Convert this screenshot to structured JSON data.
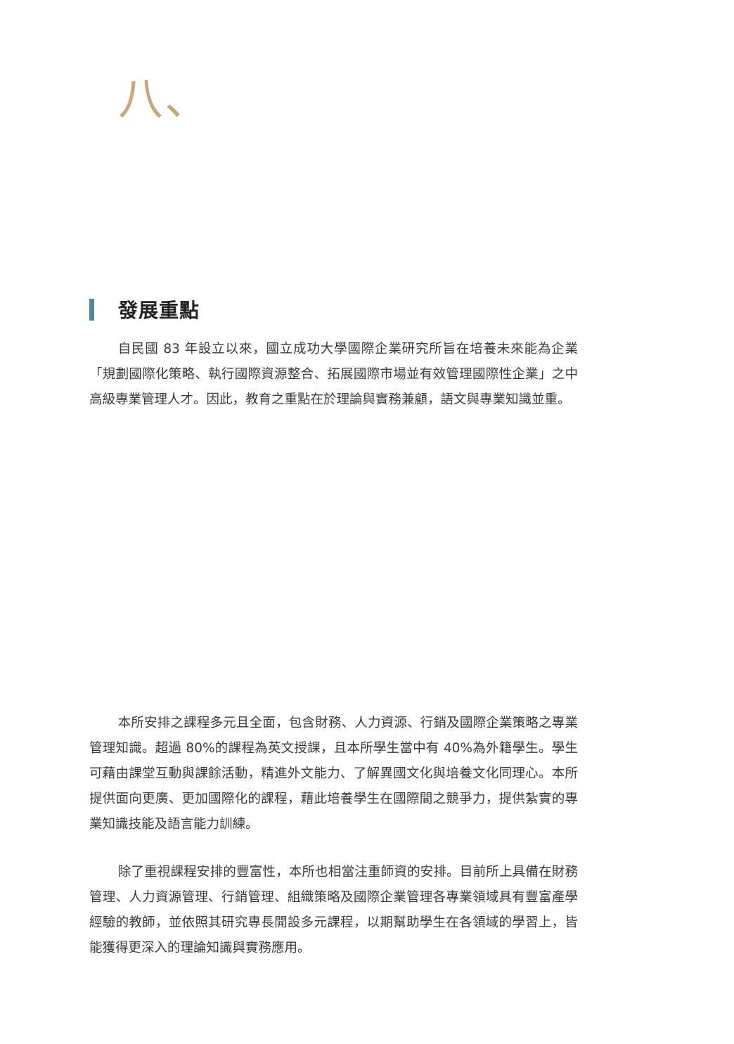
{
  "chapter": {
    "numeral": "八、"
  },
  "section": {
    "heading": "發展重點"
  },
  "paragraphs": [
    "自民國 83 年設立以來，國立成功大學國際企業研究所旨在培養未來能為企業「規劃國際化策略、執行國際資源整合、拓展國際市場並有效管理國際性企業」之中高級專業管理人才。因此，教育之重點在於理論與實務兼顧，語文與專業知識並重。",
    "本所安排之課程多元且全面，包含財務、人力資源、行銷及國際企業策略之專業管理知識。超過 80%的課程為英文授課，且本所學生當中有 40%為外籍學生。學生可藉由課堂互動與課餘活動，精進外文能力、了解異國文化與培養文化同理心。本所提供面向更廣、更加國際化的課程，藉此培養學生在國際間之競爭力，提供紮實的專業知識技能及語言能力訓練。",
    "除了重視課程安排的豐富性，本所也相當注重師資的安排。目前所上具備在財務管理、人力資源管理、行銷管理、組織策略及國際企業管理各專業領域具有豐富產學經驗的教師，並依照其研究專長開設多元課程，以期幫助學生在各領域的學習上，皆能獲得更深入的理論知識與實務應用。"
  ],
  "colors": {
    "numeral": "#c4aa7a",
    "heading_bar": "#4e8a96",
    "heading_text": "#222222",
    "body_text": "#3a3a3a"
  }
}
